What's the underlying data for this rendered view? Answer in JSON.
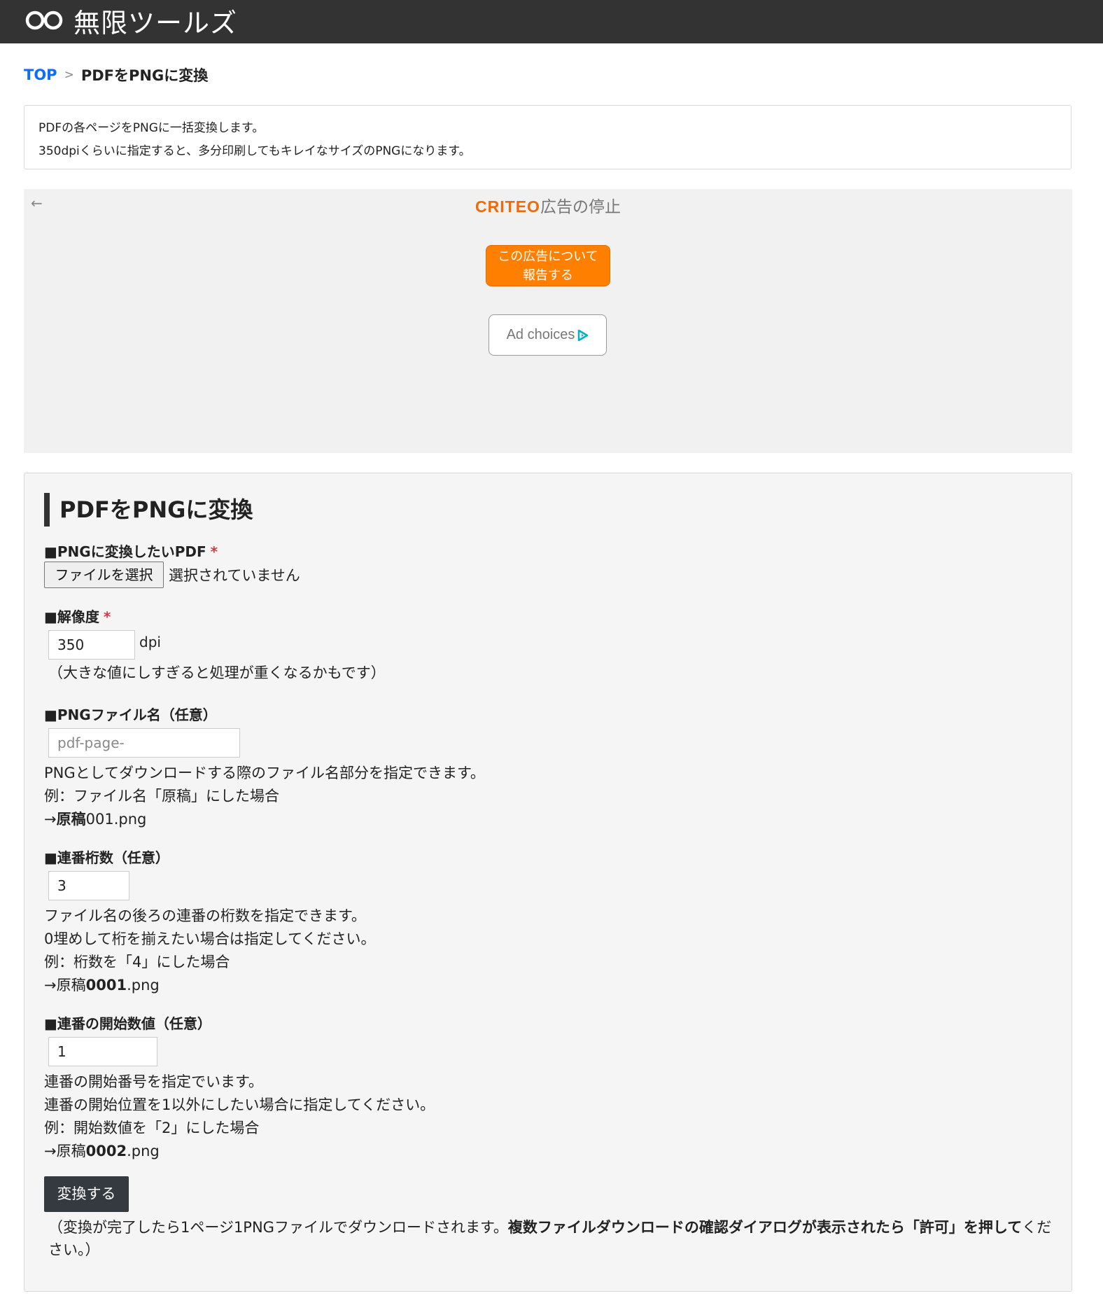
{
  "header": {
    "logo_text": "無限ツールズ"
  },
  "breadcrumb": {
    "top": "TOP",
    "sep": ">",
    "current": "PDFをPNGに変換"
  },
  "intro": {
    "line1": "PDFの各ページをPNGに一括変換します。",
    "line2": "350dpiくらいに指定すると、多分印刷してもキレイなサイズのPNGになります。"
  },
  "ad": {
    "back": "←",
    "brand": "CRITEO",
    "stop": "広告の停止",
    "report_line1": "この広告について",
    "report_line2": "報告する",
    "choices": "Ad choices"
  },
  "form": {
    "title": "PDFをPNGに変換",
    "required_mark": "*",
    "pdf": {
      "label": "■PNGに変換したいPDF",
      "button": "ファイルを選択",
      "status": "選択されていません"
    },
    "resolution": {
      "label": "■解像度",
      "value": "350",
      "unit": "dpi",
      "note": "（大きな値にしすぎると処理が重くなるかもです）"
    },
    "filename": {
      "label": "■PNGファイル名（任意）",
      "placeholder": "pdf-page-",
      "help1": "PNGとしてダウンロードする際のファイル名部分を指定できます。",
      "help2": "例：ファイル名「原稿」にした場合",
      "ex_arrow": "→",
      "ex_bold": "原稿",
      "ex_rest": "001.png"
    },
    "digits": {
      "label": "■連番桁数（任意）",
      "value": "3",
      "help1": "ファイル名の後ろの連番の桁数を指定できます。",
      "help2": "0埋めして桁を揃えたい場合は指定してください。",
      "help3": "例：桁数を「4」にした場合",
      "ex_pre": "→原稿",
      "ex_bold": "0001",
      "ex_post": ".png"
    },
    "start": {
      "label": "■連番の開始数値（任意）",
      "value": "1",
      "help1": "連番の開始番号を指定でいます。",
      "help2": "連番の開始位置を1以外にしたい場合に指定してください。",
      "help3": "例：開始数値を「2」にした場合",
      "ex_pre": "→原稿",
      "ex_bold": "0002",
      "ex_post": ".png"
    },
    "submit": "変換する",
    "note_pre": "（変換が完了したら1ページ1PNGファイルでダウンロードされます。",
    "note_bold": "複数ファイルダウンロードの確認ダイアログが表示されたら「許可」を押して",
    "note_post": "ください。）"
  },
  "colors": {
    "header_bg": "#333333",
    "link": "#0d6efd",
    "required": "#dc3545",
    "ad_report": "#ff8000",
    "criteo": "#f06a0a",
    "submit_bg": "#343a40"
  }
}
